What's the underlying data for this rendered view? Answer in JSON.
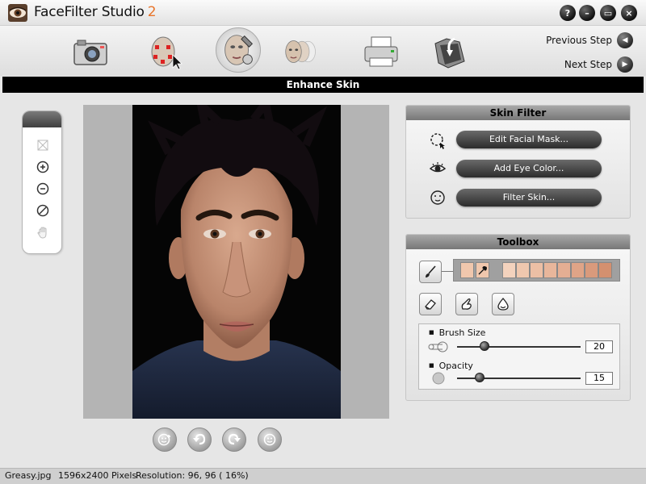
{
  "app": {
    "title": "FaceFilter Studio",
    "version": "2"
  },
  "window_buttons": {
    "help": "?",
    "minimize": "–",
    "maximize": "▭",
    "close": "×"
  },
  "toolbar": {
    "steps": [
      {
        "icon": "camera-icon"
      },
      {
        "icon": "face-markers-icon"
      },
      {
        "icon": "enhance-face-icon",
        "active": true
      },
      {
        "icon": "morph-faces-icon"
      },
      {
        "icon": "printer-icon"
      },
      {
        "icon": "export-folder-icon"
      }
    ],
    "previous_step": "Previous Step",
    "next_step": "Next Step"
  },
  "section_title": "Enhance Skin",
  "skin_filter": {
    "title": "Skin Filter",
    "edit_mask": "Edit Facial Mask...",
    "eye_color": "Add Eye Color...",
    "filter_skin": "Filter Skin..."
  },
  "toolbox": {
    "title": "Toolbox",
    "selected_color": "#f0c7ad",
    "swatches": [
      "#f3d2bd",
      "#efc7ae",
      "#ecbfa5",
      "#e8b69b",
      "#e4ae93",
      "#dfa487",
      "#d99a7c",
      "#d4906f"
    ],
    "brush_size": {
      "label": "Brush Size",
      "value": "20",
      "fraction": 0.22
    },
    "opacity": {
      "label": "Opacity",
      "value": "15",
      "fraction": 0.18
    }
  },
  "status": {
    "filename": "Greasy.jpg",
    "pixels": "1596x2400 Pixels",
    "resolution": "Resolution: 96, 96 ( 16%)"
  }
}
